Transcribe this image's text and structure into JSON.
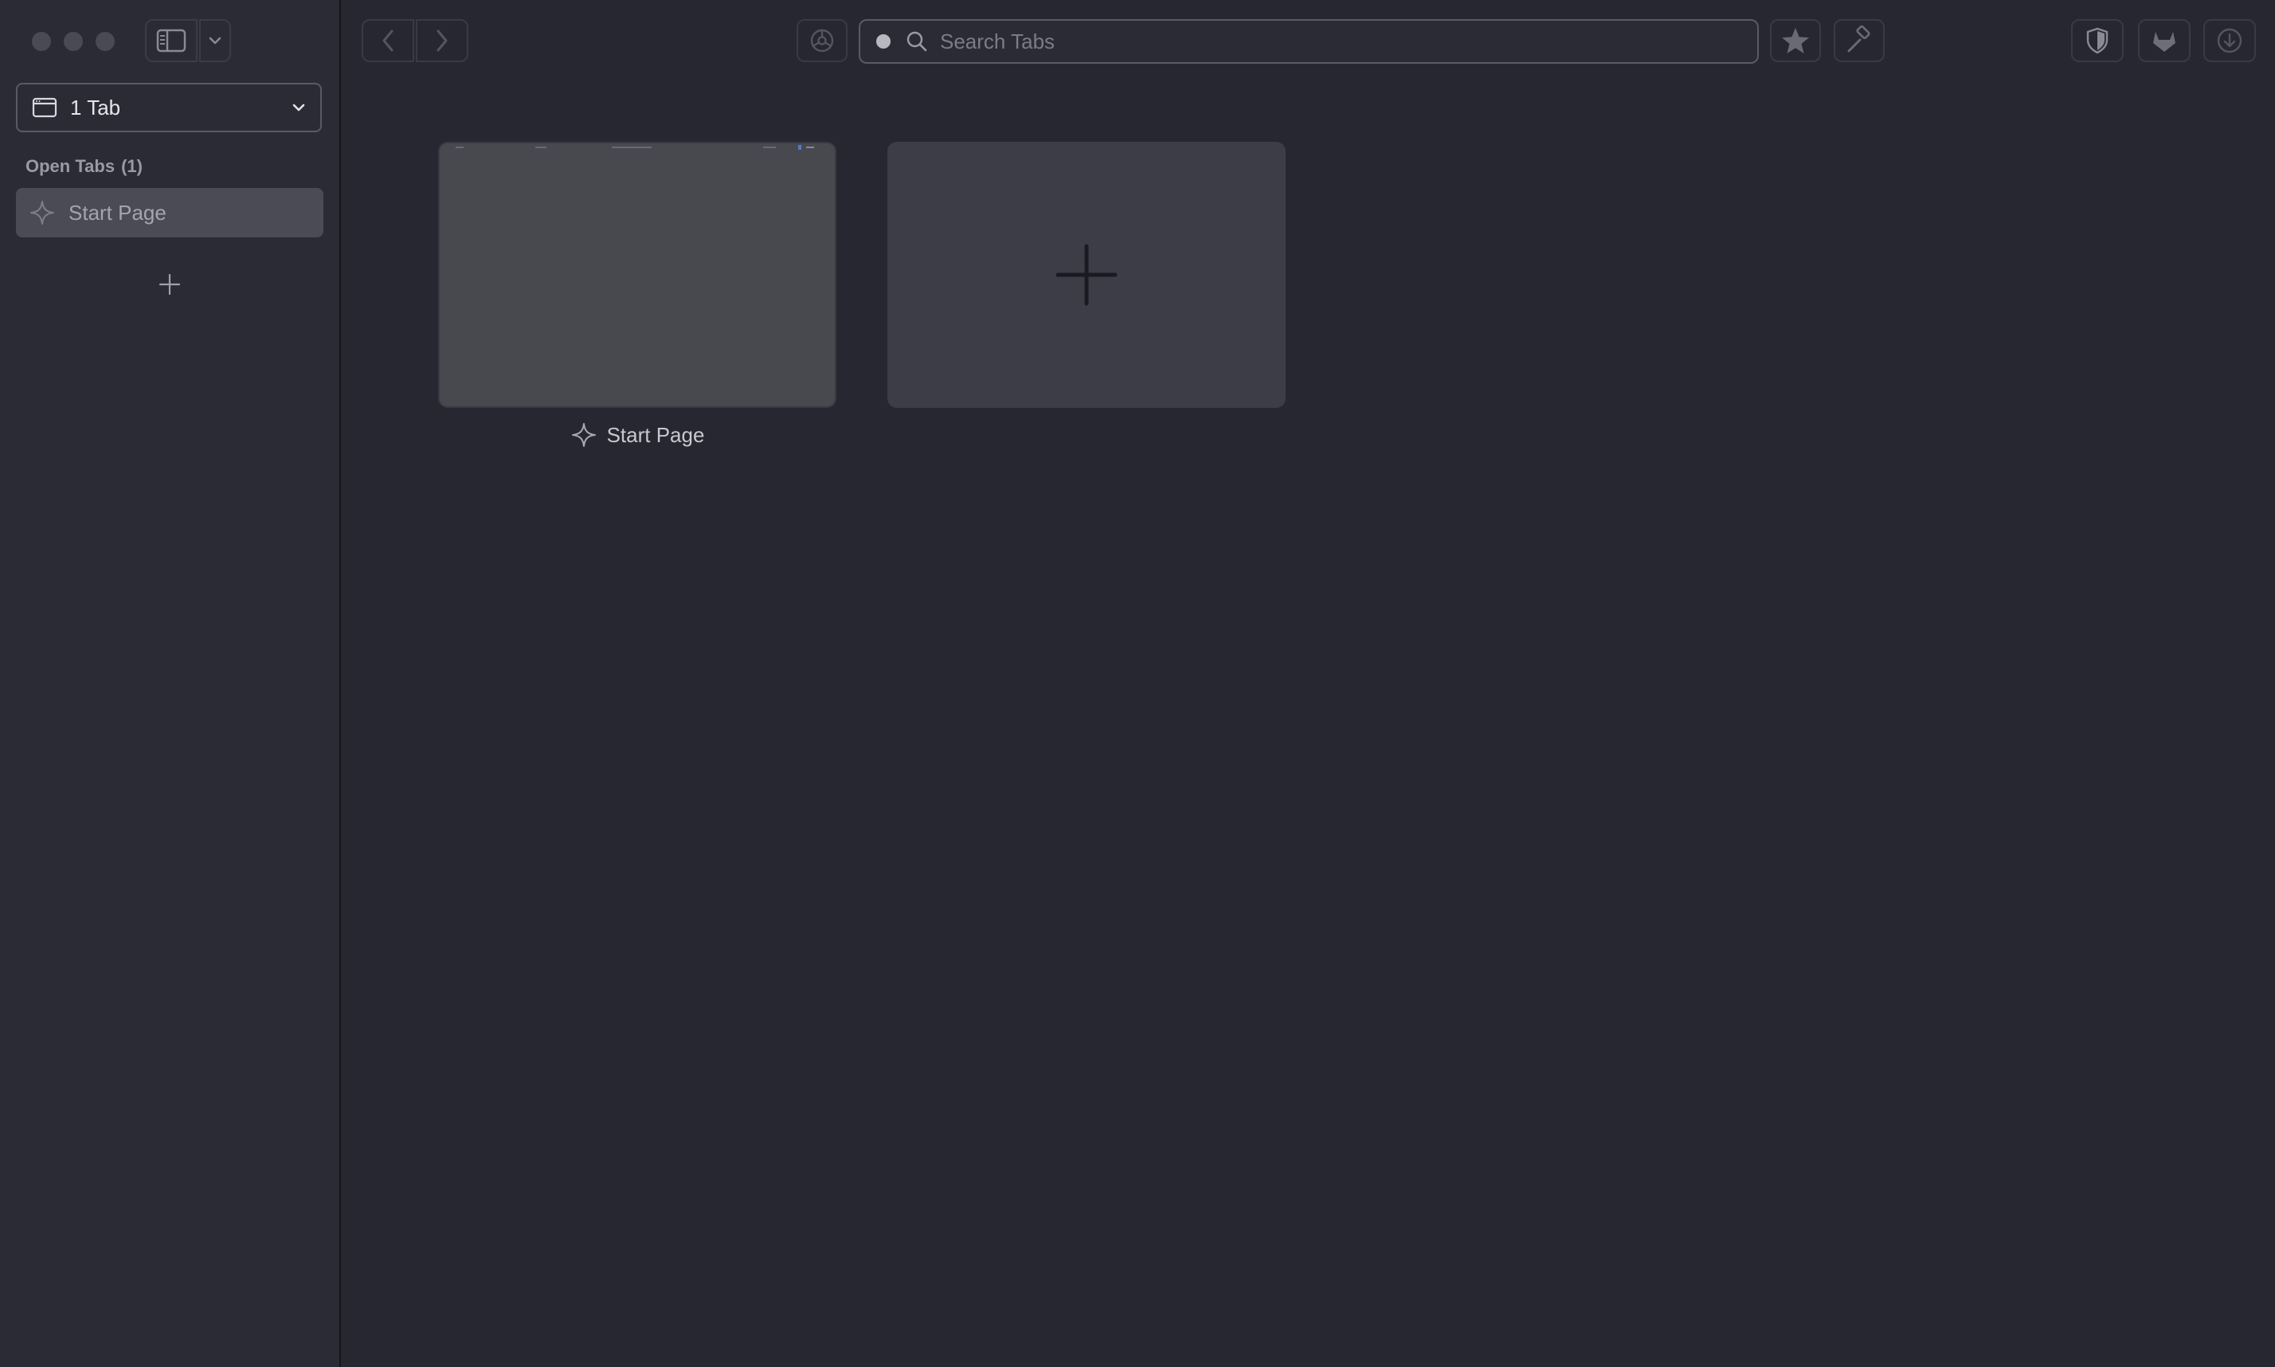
{
  "sidebar": {
    "tab_group_label": "1 Tab",
    "section_title": "Open Tabs",
    "section_count": "(1)",
    "tabs": [
      {
        "label": "Start Page"
      }
    ]
  },
  "toolbar": {
    "search_placeholder": "Search Tabs"
  },
  "overview": {
    "tabs": [
      {
        "title": "Start Page"
      }
    ]
  },
  "colors": {
    "background": "#272732",
    "sidebar": "#2b2b36",
    "selected_tab": "#4b4b56",
    "card": "#48484f",
    "new_tab_card": "#3d3d48"
  },
  "icons": {
    "tab_group": "window-icon",
    "tab_favicon": "sparkle-icon",
    "add": "plus-icon",
    "back": "chevron-left-icon",
    "forward": "chevron-right-icon",
    "bookmark": "star-icon",
    "extension": "hammer-icon",
    "shield": "shield-icon",
    "gitlab": "gitlab-icon",
    "download": "download-icon"
  }
}
